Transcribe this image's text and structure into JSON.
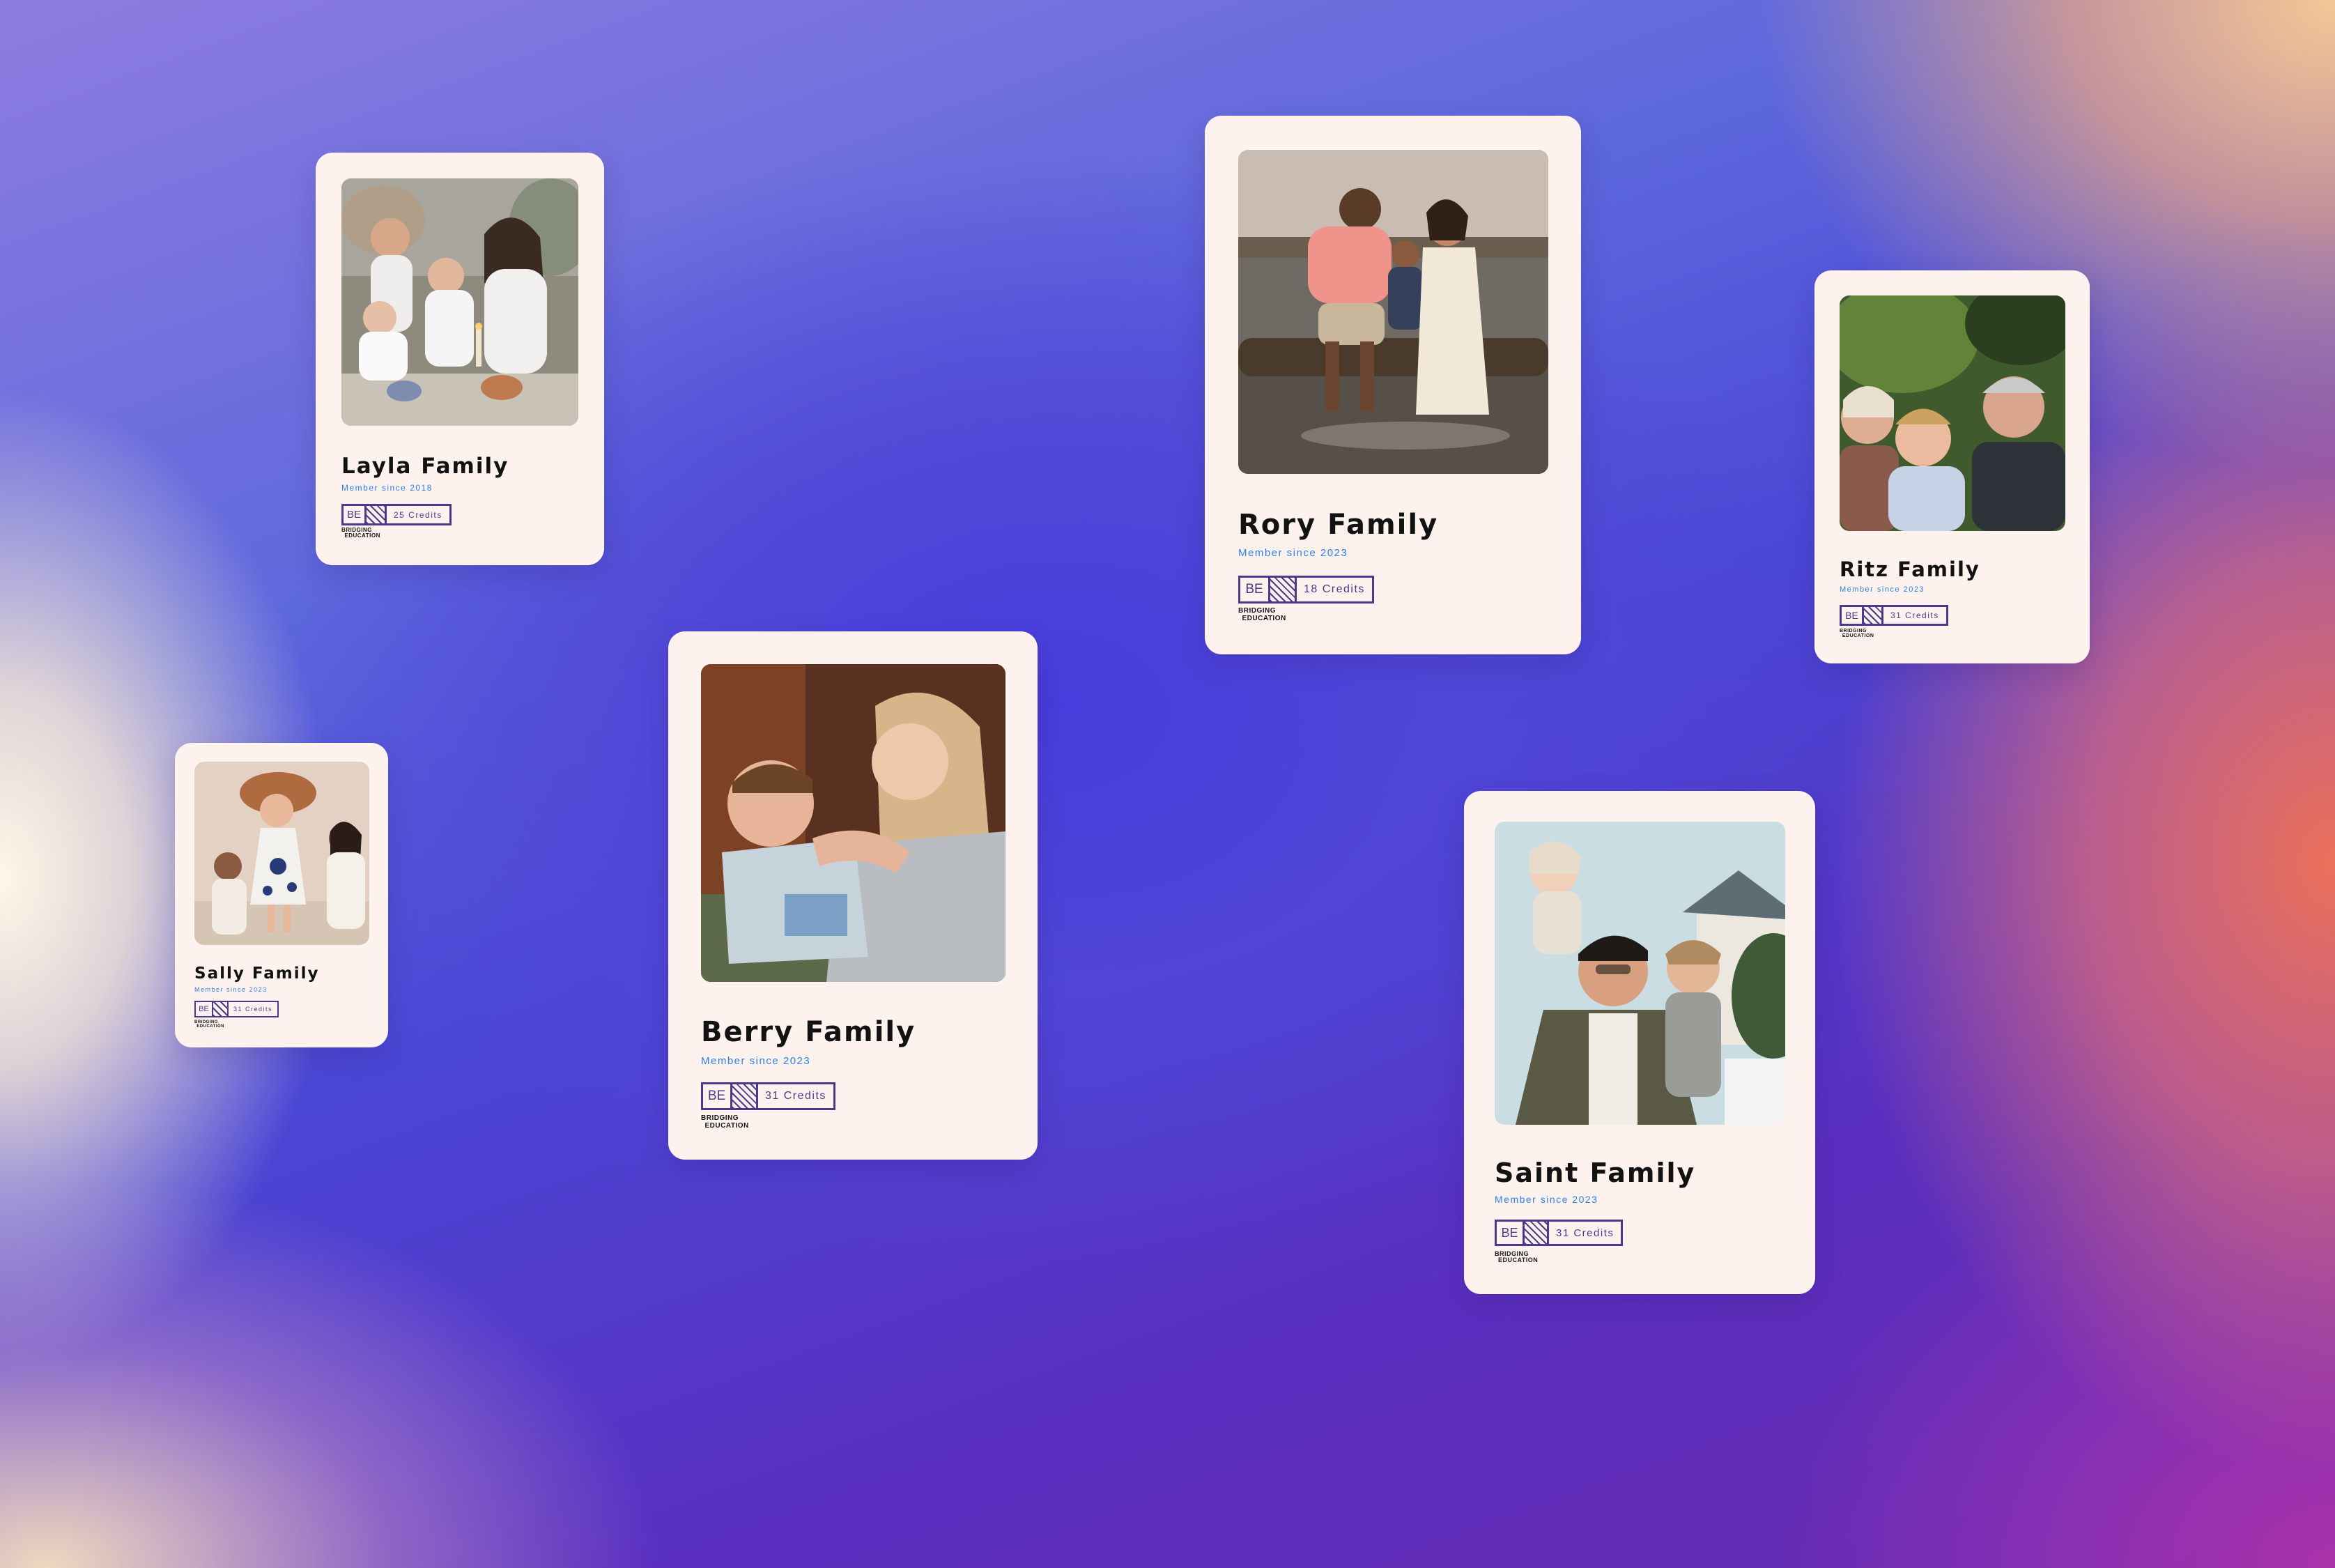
{
  "brand": {
    "line1": "BRIDGING",
    "line2": "EDUCATION"
  },
  "badge_prefix": "BE",
  "colors": {
    "card": "#fdf2ee",
    "member_text": "#2f7fe6",
    "badge": "#4b3a8c",
    "name_text": "#121212"
  },
  "cards": [
    {
      "name": "Layla Family",
      "member_since": "Member since 2018",
      "credits": "25 Credits",
      "photo": "family-dinner-photo"
    },
    {
      "name": "Rory Family",
      "member_since": "Member since 2023",
      "credits": "18 Credits",
      "photo": "family-lake-photo"
    },
    {
      "name": "Ritz Family",
      "member_since": "Member since 2023",
      "credits": "31 Credits",
      "photo": "family-hug-photo"
    },
    {
      "name": "Sally Family",
      "member_since": "Member since 2023",
      "credits": "31 Credits",
      "photo": "child-jumping-photo"
    },
    {
      "name": "Berry Family",
      "member_since": "Member since 2023",
      "credits": "31 Credits",
      "photo": "mother-son-photo"
    },
    {
      "name": "Saint Family",
      "member_since": "Member since 2023",
      "credits": "31 Credits",
      "photo": "father-kids-photo"
    }
  ]
}
